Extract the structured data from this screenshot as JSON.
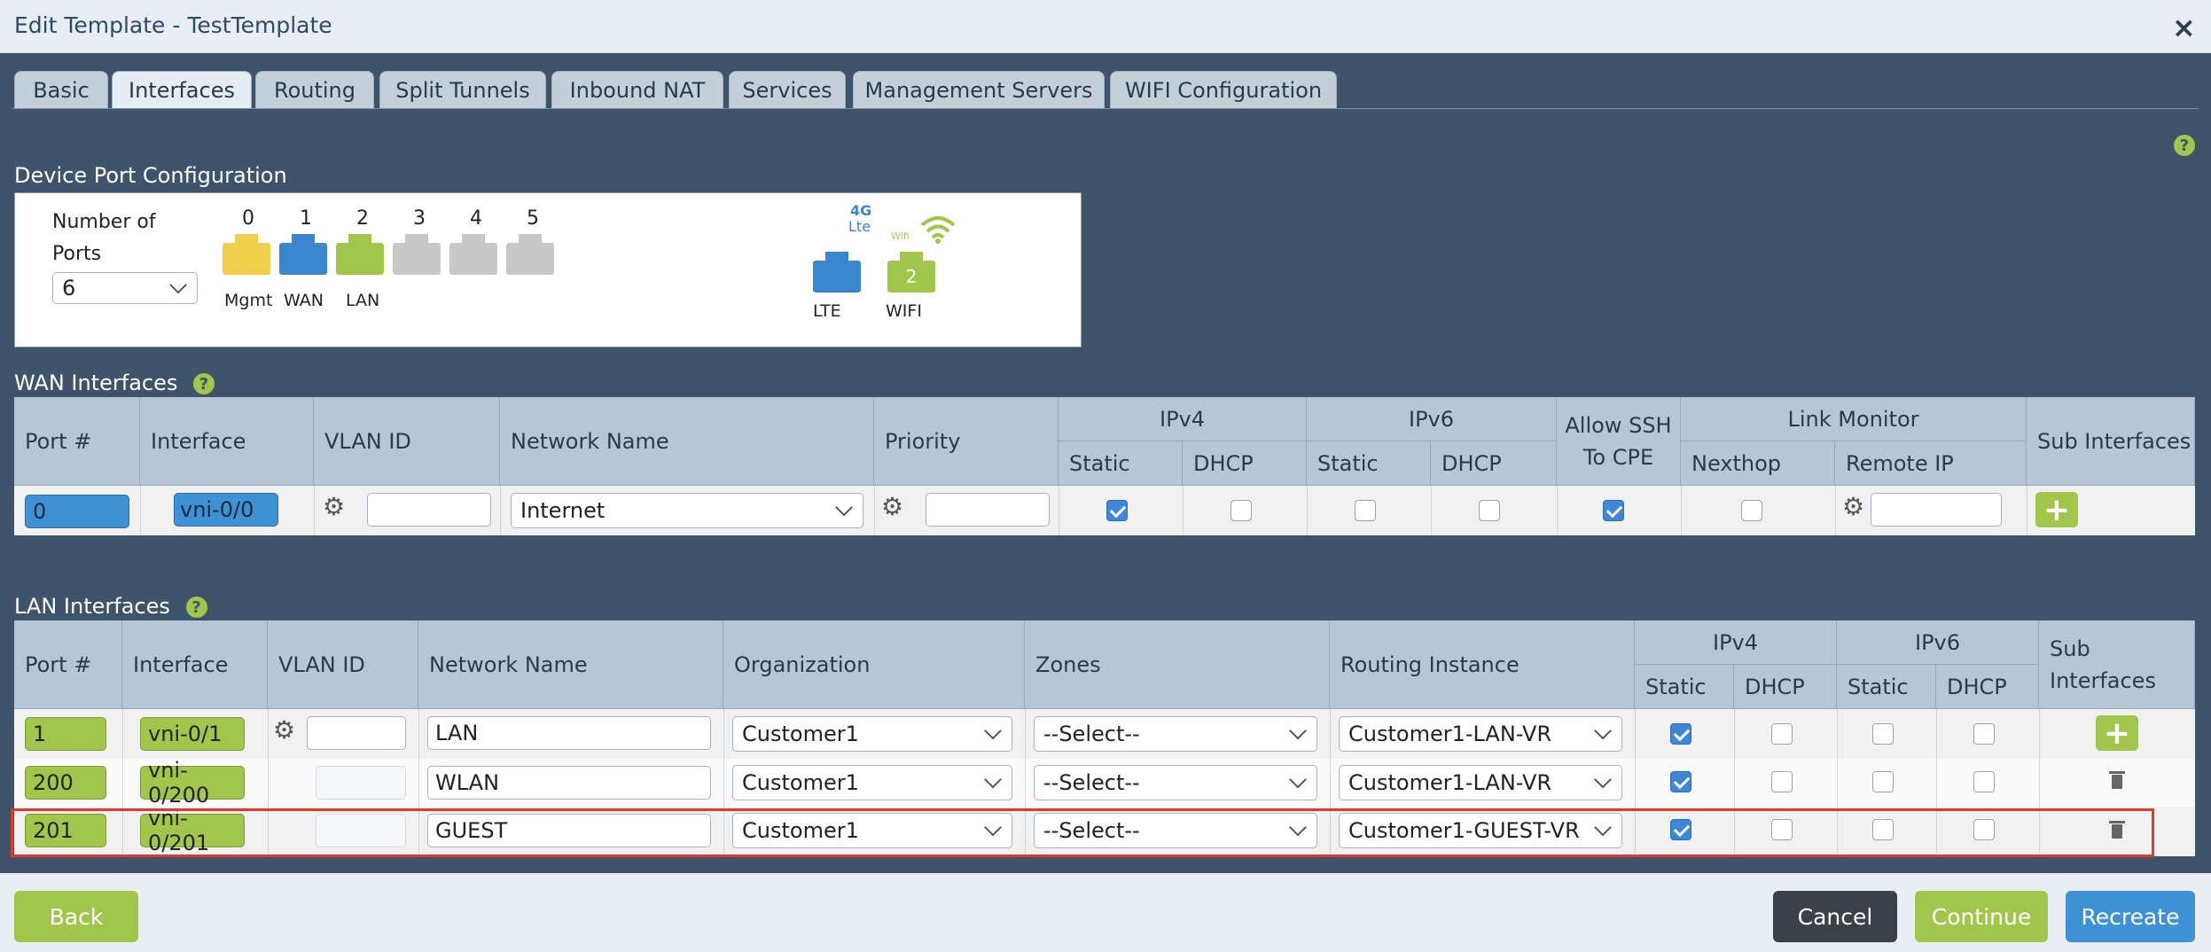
{
  "window": {
    "title": "Edit Template - TestTemplate",
    "close_icon": "×"
  },
  "tabs": [
    "Basic",
    "Interfaces",
    "Routing",
    "Split Tunnels",
    "Inbound NAT",
    "Services",
    "Management Servers",
    "WIFI Configuration"
  ],
  "active_tab": "Interfaces",
  "device_ports": {
    "section_title": "Device Port Configuration",
    "number_of_ports_label_line1": "Number of",
    "number_of_ports_label_line2": "Ports",
    "number_of_ports_value": "6",
    "port_numbers": [
      "0",
      "1",
      "2",
      "3",
      "4",
      "5"
    ],
    "port_labels": [
      "Mgmt",
      "WAN",
      "LAN"
    ],
    "port_colors": [
      "#f2cf4a",
      "#3a87cf",
      "#a2c64b",
      "#c8c8c8",
      "#c8c8c8",
      "#c8c8c8"
    ],
    "lte_badge": "4G",
    "lte_sub": "Lte",
    "lte_label": "LTE",
    "wifi_badge": "Wifi",
    "wifi_port_number": "2",
    "wifi_label": "WIFI"
  },
  "wan": {
    "section_title": "WAN Interfaces",
    "help_icon": "?",
    "headers": {
      "port": "Port #",
      "interface": "Interface",
      "vlan": "VLAN ID",
      "network": "Network Name",
      "priority": "Priority",
      "ipv4": "IPv4",
      "ipv6": "IPv6",
      "static": "Static",
      "dhcp": "DHCP",
      "ssh1": "Allow SSH",
      "ssh2": "To CPE",
      "link_monitor": "Link Monitor",
      "nexthop": "Nexthop",
      "remote_ip": "Remote IP",
      "sub": "Sub Interfaces"
    },
    "rows": [
      {
        "port": "0",
        "interface": "vni-0/0",
        "vlan": "",
        "network": "Internet",
        "priority": "",
        "ipv4_static": true,
        "ipv4_dhcp": false,
        "ipv6_static": false,
        "ipv6_dhcp": false,
        "ssh": true,
        "nexthop": false,
        "remote_ip": ""
      }
    ]
  },
  "lan": {
    "section_title": "LAN Interfaces",
    "help_icon": "?",
    "headers": {
      "port": "Port #",
      "interface": "Interface",
      "vlan": "VLAN ID",
      "network": "Network Name",
      "org": "Organization",
      "zones": "Zones",
      "ri": "Routing Instance",
      "ipv4": "IPv4",
      "ipv6": "IPv6",
      "static": "Static",
      "dhcp": "DHCP",
      "sub1": "Sub",
      "sub2": "Interfaces"
    },
    "rows": [
      {
        "port": "1",
        "interface": "vni-0/1",
        "vlan": "",
        "network": "LAN",
        "org": "Customer1",
        "zones": "--Select--",
        "ri": "Customer1-LAN-VR",
        "ipv4_static": true,
        "ipv4_dhcp": false,
        "ipv6_static": false,
        "ipv6_dhcp": false
      },
      {
        "port": "200",
        "interface": "vni-0/200",
        "vlan": "",
        "network": "WLAN",
        "org": "Customer1",
        "zones": "--Select--",
        "ri": "Customer1-LAN-VR",
        "ipv4_static": true,
        "ipv4_dhcp": false,
        "ipv6_static": false,
        "ipv6_dhcp": false
      },
      {
        "port": "201",
        "interface": "vni-0/201",
        "vlan": "",
        "network": "GUEST",
        "org": "Customer1",
        "zones": "--Select--",
        "ri": "Customer1-GUEST-VR",
        "ipv4_static": true,
        "ipv4_dhcp": false,
        "ipv6_static": false,
        "ipv6_dhcp": false
      }
    ]
  },
  "icons": {
    "gear": "⚙",
    "plus": "+",
    "help": "?"
  },
  "footer": {
    "back": "Back",
    "cancel": "Cancel",
    "continue": "Continue",
    "recreate": "Recreate"
  },
  "colors": {
    "accent_green": "#a2c64b",
    "accent_blue": "#3f91d6",
    "panel": "#3e546b",
    "highlight": "#e03c2e"
  }
}
